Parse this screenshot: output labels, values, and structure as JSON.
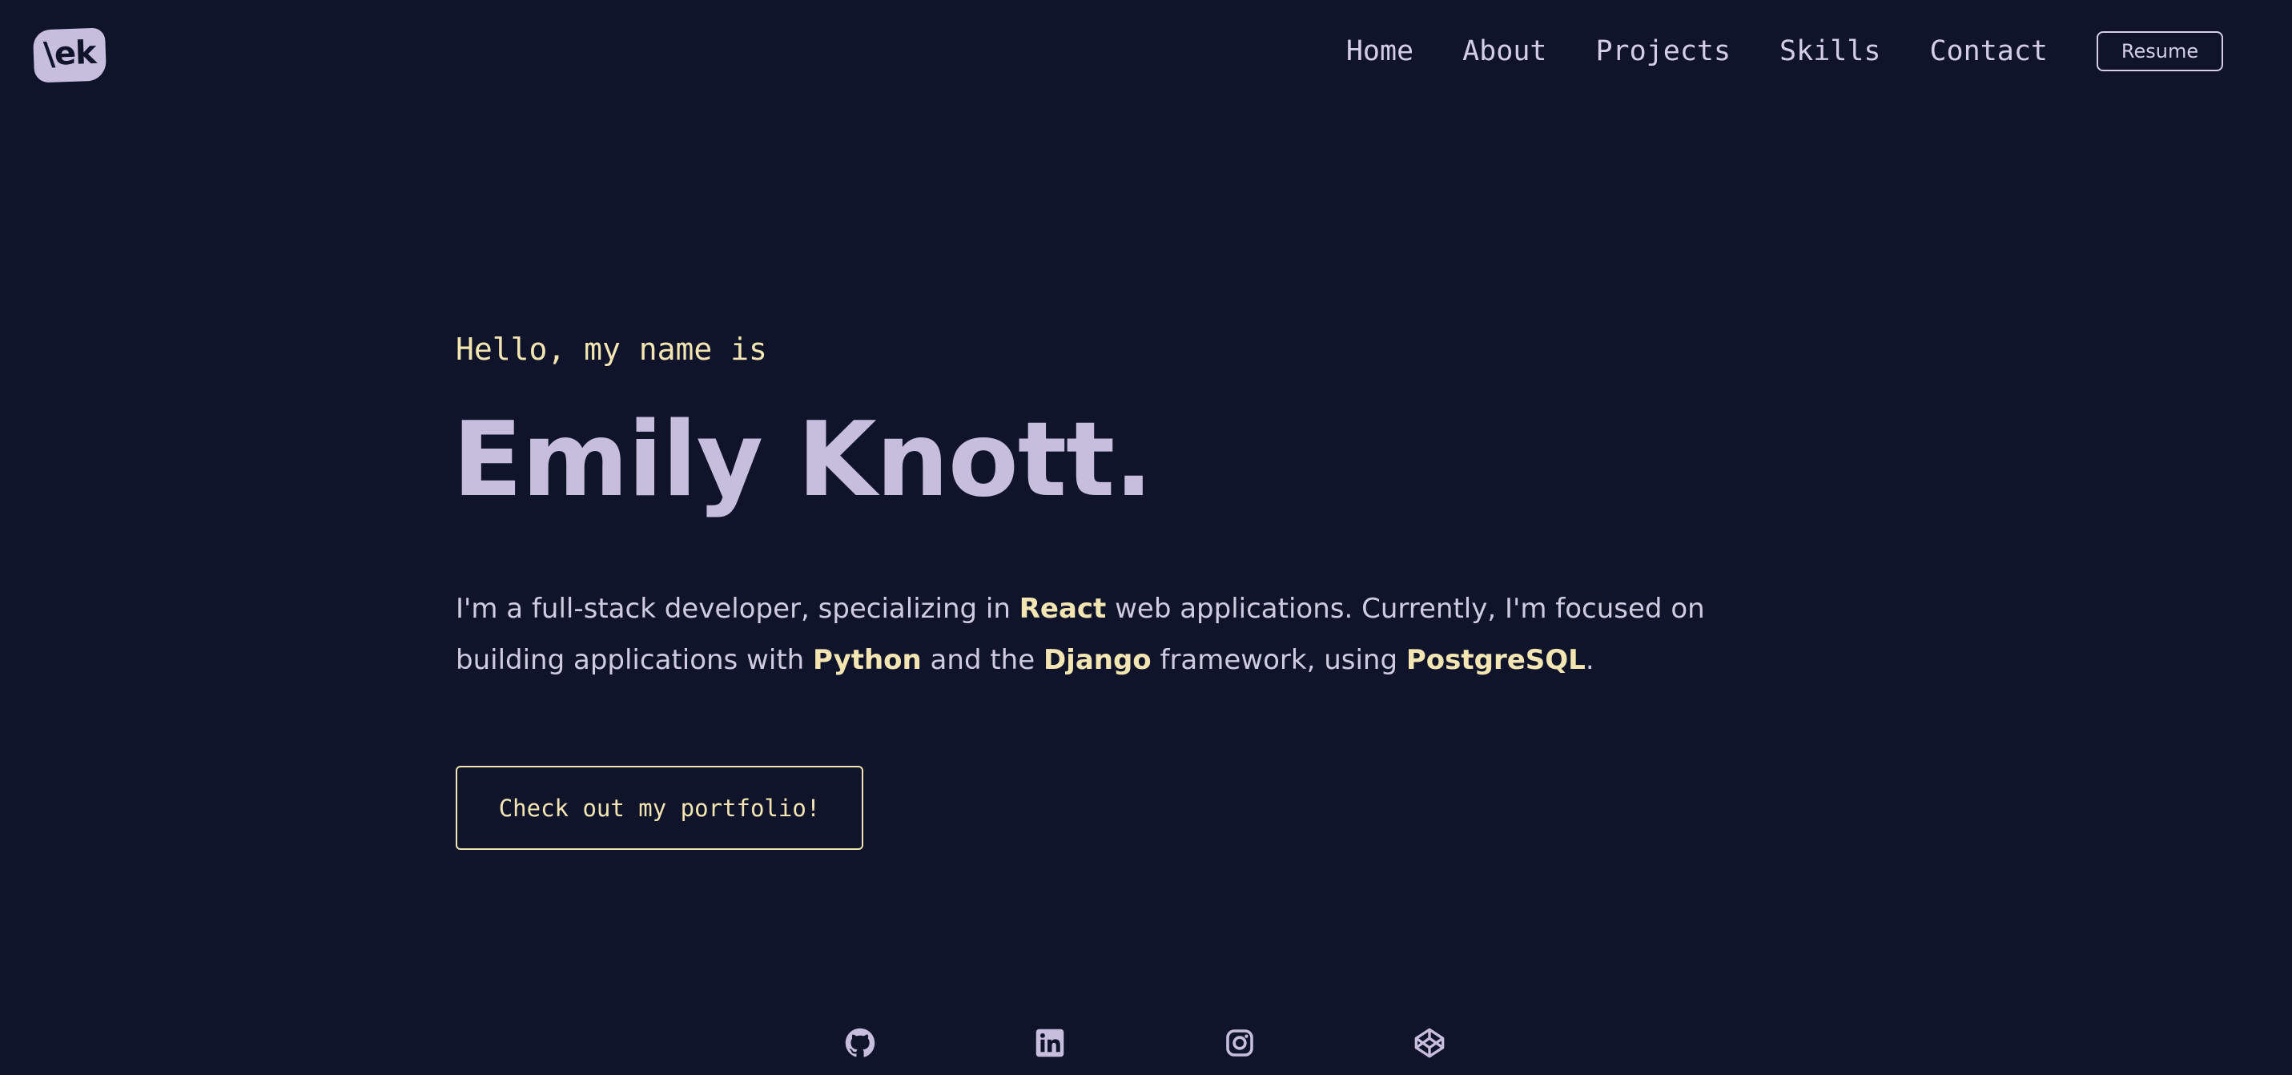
{
  "logo": {
    "text": "\\ek"
  },
  "nav": {
    "items": [
      "Home",
      "About",
      "Projects",
      "Skills",
      "Contact"
    ],
    "resume_label": "Resume"
  },
  "hero": {
    "greeting": "Hello, my name is",
    "name": "Emily Knott.",
    "bio": {
      "t1": "I'm a full-stack developer, specializing in ",
      "h1": "React",
      "t2": " web applications. Currently, I'm focused on building applications with ",
      "h2": "Python",
      "t3": " and the ",
      "h3": "Django",
      "t4": " framework, using ",
      "h4": "PostgreSQL",
      "t5": "."
    },
    "cta_label": "Check out my portfolio!"
  },
  "social": {
    "icons": [
      "github-icon",
      "linkedin-icon",
      "instagram-icon",
      "codepen-icon"
    ]
  },
  "colors": {
    "background": "#10142a",
    "accent_yellow": "#f3e6b3",
    "accent_lavender": "#c7bddc",
    "text": "#d3cde6"
  }
}
